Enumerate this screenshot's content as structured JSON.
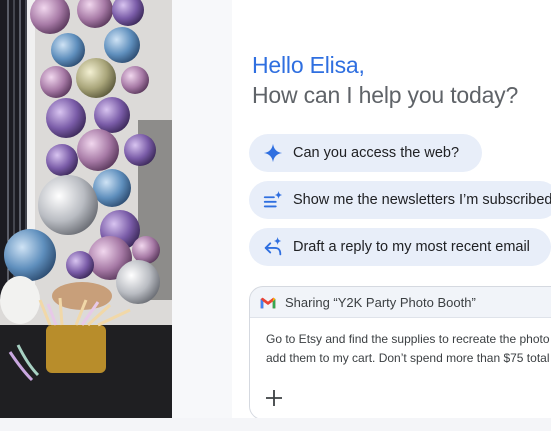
{
  "greeting": {
    "hello": "Hello Elisa,",
    "prompt": "How can I help you today?"
  },
  "suggestions": [
    {
      "icon": "sparkle-icon",
      "label": "Can you access the web?"
    },
    {
      "icon": "list-sparkle-icon",
      "label": "Show me the newsletters I’m subscribed"
    },
    {
      "icon": "reply-sparkle-icon",
      "label": "Draft a reply to my most recent email"
    }
  ],
  "composer": {
    "sharing_icon": "gmail-icon",
    "sharing_label": "Sharing “Y2K Party Photo Booth”",
    "input_line1": "Go to Etsy and find the supplies to recreate the photo",
    "input_line2": "add them to my cart. Don’t spend more than $75 total",
    "add_icon": "plus-icon"
  },
  "colors": {
    "accent": "#2f6fe0",
    "chip_bg": "#e8eef9"
  }
}
